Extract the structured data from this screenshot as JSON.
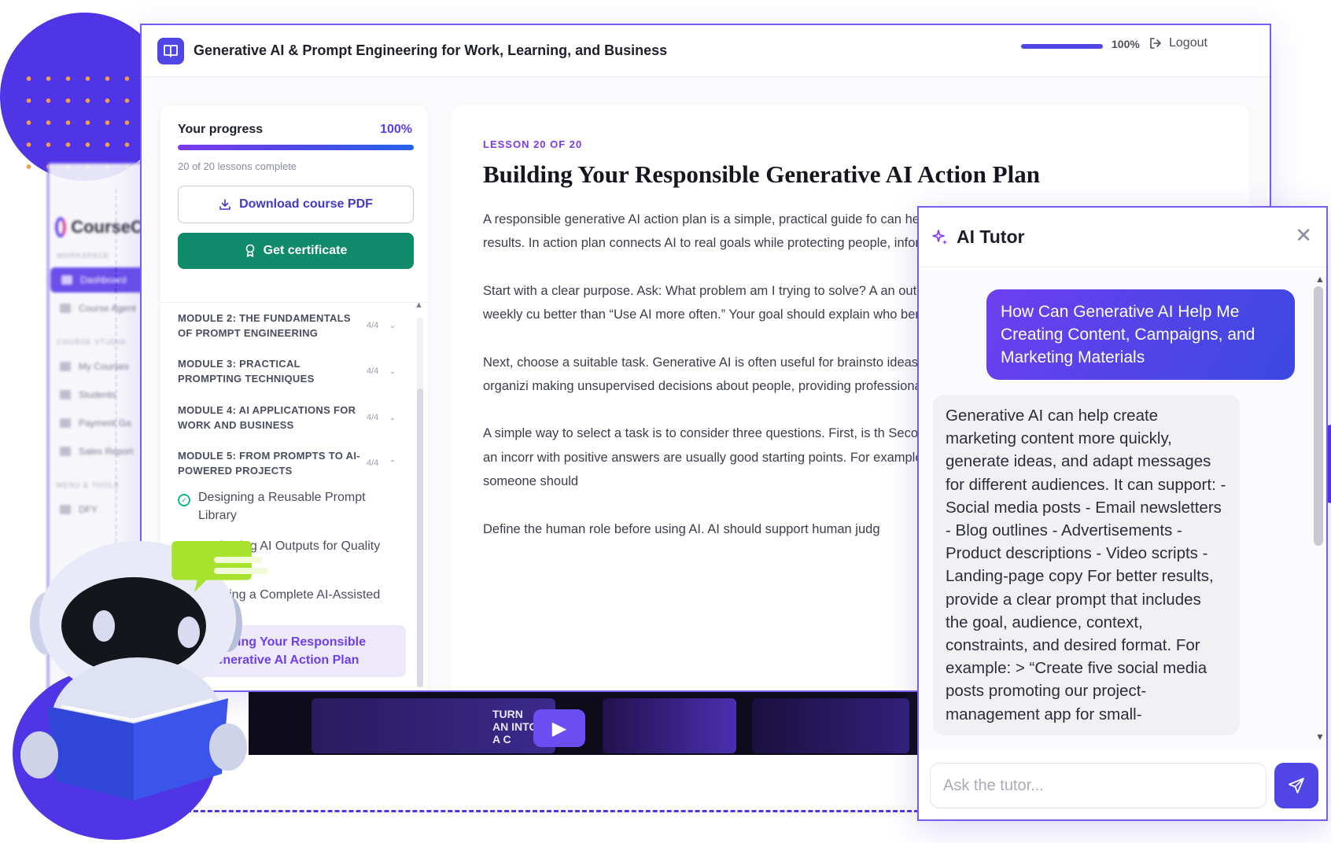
{
  "colors": {
    "brand": "#4f46e5",
    "accent": "#7c3aed",
    "success": "#0f8a6a",
    "border": "#7a5bf0"
  },
  "background_app": {
    "logo_text": "CourseCl",
    "section_workspace": "WORKSPACE",
    "section_studio": "COURSE STUDIO",
    "section_tools": "MENU & TOOLS",
    "items": [
      {
        "label": "Dashboard",
        "active": true
      },
      {
        "label": "Course Agent"
      },
      {
        "label": "My Courses"
      },
      {
        "label": "Students"
      },
      {
        "label": "Payment Ga"
      },
      {
        "label": "Sales Report"
      },
      {
        "label": "DFY"
      }
    ]
  },
  "header": {
    "title": "Generative AI & Prompt Engineering for Work, Learning, and Business",
    "progress_fraction": 1.0,
    "progress_label": "100%",
    "logout_label": "Logout"
  },
  "sidebar": {
    "progress_title": "Your progress",
    "progress_percent": "100%",
    "progress_fraction": 1.0,
    "progress_sub": "20 of 20 lessons complete",
    "download_label": "Download course PDF",
    "certificate_label": "Get certificate",
    "modules": [
      {
        "title": "MODULE 2: THE FUNDAMENTALS OF PROMPT ENGINEERING",
        "count": "4/4",
        "expanded": false
      },
      {
        "title": "MODULE 3: PRACTICAL PROMPTING TECHNIQUES",
        "count": "4/4",
        "expanded": false
      },
      {
        "title": "MODULE 4: AI APPLICATIONS FOR WORK AND BUSINESS",
        "count": "4/4",
        "expanded": false
      },
      {
        "title": "MODULE 5: FROM PROMPTS TO AI-POWERED PROJECTS",
        "count": "4/4",
        "expanded": true
      }
    ],
    "lessons": [
      {
        "title": "Designing a Reusable Prompt Library",
        "done": true
      },
      {
        "title": "Evaluating AI Outputs for Quality",
        "done": true
      },
      {
        "title": "Creating a Complete AI-Assisted",
        "done": true
      },
      {
        "title": "Building Your Responsible Generative AI Action Plan",
        "active": true
      }
    ]
  },
  "lesson": {
    "kicker": "LESSON 20 OF 20",
    "title": "Building Your Responsible Generative AI Action Plan",
    "paragraphs": [
      "A responsible generative AI action plan is a simple, practical guide fo can help, what risks to manage, and how you will measure results. In action plan connects AI to real goals while protecting people, informa",
      "Start with a clear purpose. Ask: What problem am I trying to solve? A an outcome. For example, “Use AI to create a first draft of a weekly cu better than “Use AI more often.” Your goal should explain who benefit review the results.",
      "Next, choose a suitable task. Generative AI is often useful for brainsto ideas, creating outlines, translating, drafting messages, and organizi making unsupervised decisions about people, providing professiona sensitive information in an unapproved tool.",
      "A simple way to select a task is to consider three questions. First, is th Second, can a human easily review the result? Third, would an incorr with positive answers are usually good starting points. For example, g headlines is a lower-risk task than deciding whether someone should",
      "Define the human role before using AI. AI should support human judg"
    ]
  },
  "tutor": {
    "title": "AI Tutor",
    "user_message": "How Can Generative AI Help Me Creating Content, Campaigns, and Marketing Materials",
    "bot_message": "Generative AI can help create marketing content more quickly, generate ideas, and adapt messages for different audiences. It can support: - Social media posts - Email newsletters - Blog outlines - Advertisements - Product descriptions - Video scripts - Landing-page copy For better results, provide a clear prompt that includes the goal, audience, context, constraints, and desired format. For example: > “Create five social media posts promoting our project-management app for small-",
    "input_placeholder": "Ask the tutor...",
    "icons": {
      "header": "sparkle-icon",
      "close": "close-icon",
      "send": "send-icon"
    }
  },
  "video": {
    "overlay_text": "TURN AN INTO A C"
  }
}
